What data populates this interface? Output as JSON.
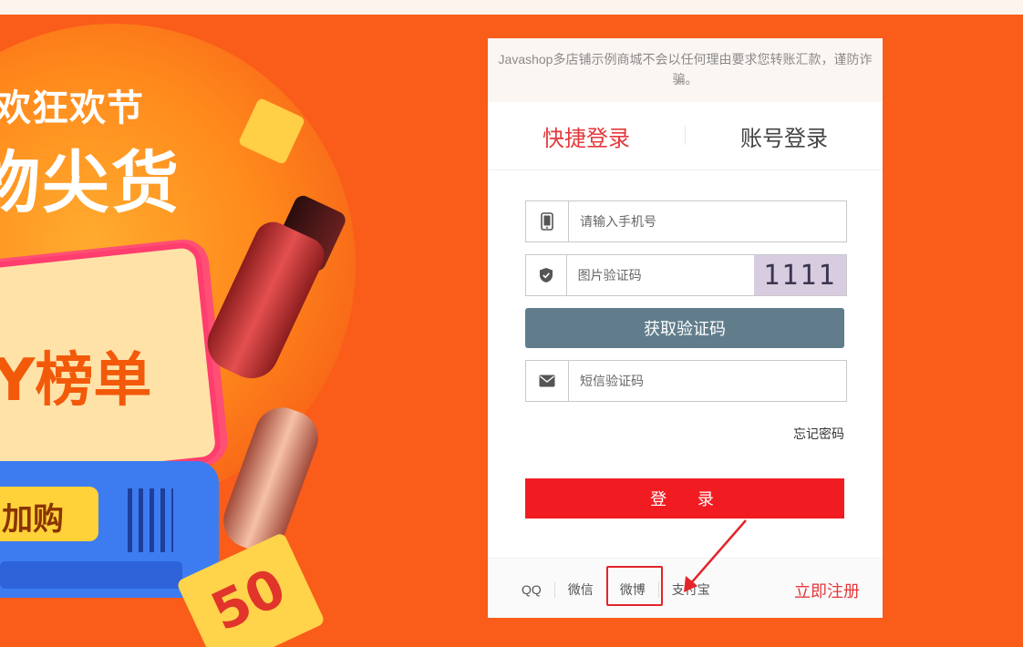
{
  "banner": {
    "headline1": "欢狂欢节",
    "headline2": "物尖货",
    "card_text": "Y榜单",
    "chip_text": "加购",
    "ticket_small": "50",
    "ticket_big": "50"
  },
  "login": {
    "notice": "Javashop多店铺示例商城不会以任何理由要求您转账汇款，谨防诈骗。",
    "tabs": [
      {
        "label": "快捷登录",
        "active": true
      },
      {
        "label": "账号登录",
        "active": false
      }
    ],
    "phone_placeholder": "请输入手机号",
    "captcha_placeholder": "图片验证码",
    "captcha_text": "1111",
    "sms_button": "获取验证码",
    "sms_code_placeholder": "短信验证码",
    "forgot_password": "忘记密码",
    "login_button": "登 录",
    "social": [
      "QQ",
      "微信",
      "微博",
      "支付宝"
    ],
    "register": "立即注册"
  },
  "colors": {
    "accent": "#e4393c",
    "login_button": "#f11c22",
    "sms_button": "#617d8b",
    "background": "#fa5c19"
  }
}
